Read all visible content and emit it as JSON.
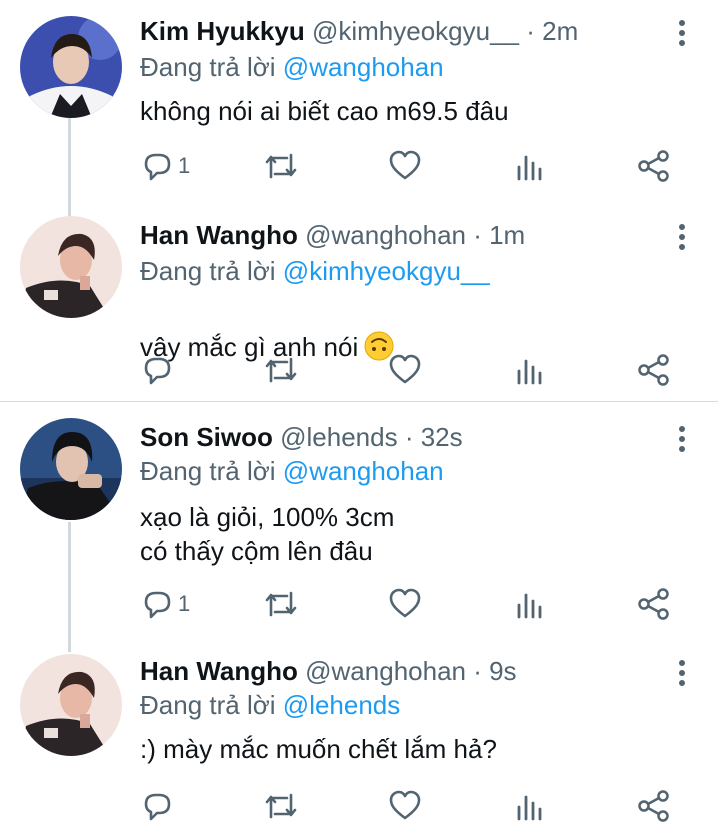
{
  "reply_prefix": "Đang trả lời",
  "tweets": [
    {
      "name": "Kim Hyukkyu",
      "meta": "@kimhyeokgyu__ · 2m",
      "reply_to": "@wanghohan",
      "text": "không nói ai biết cao m69.5 đâu",
      "reply_count": "1",
      "avatar": "avatar-kim"
    },
    {
      "name": "Han Wangho",
      "meta": "@wanghohan · 1m",
      "reply_to": "@kimhyeokgyu__",
      "text": "vậy mắc gì anh nói",
      "emoji": "upside-down-face-emoji",
      "reply_count": "",
      "avatar": "avatar-han"
    },
    {
      "name": "Son Siwoo",
      "meta": "@lehends · 32s",
      "reply_to": "@wanghohan",
      "text": "xạo là giỏi, 100% 3cm\ncó thấy cộm lên đâu",
      "reply_count": "1",
      "avatar": "avatar-son"
    },
    {
      "name": "Han Wangho",
      "meta": "@wanghohan · 9s",
      "reply_to": "@lehends",
      "text": ":) mày mắc muốn chết lắm hả?",
      "reply_count": "",
      "avatar": "avatar-han"
    }
  ],
  "colors": {
    "accent": "#1d9bf0",
    "secondary": "#536471",
    "thread_line": "#cfd9de"
  }
}
